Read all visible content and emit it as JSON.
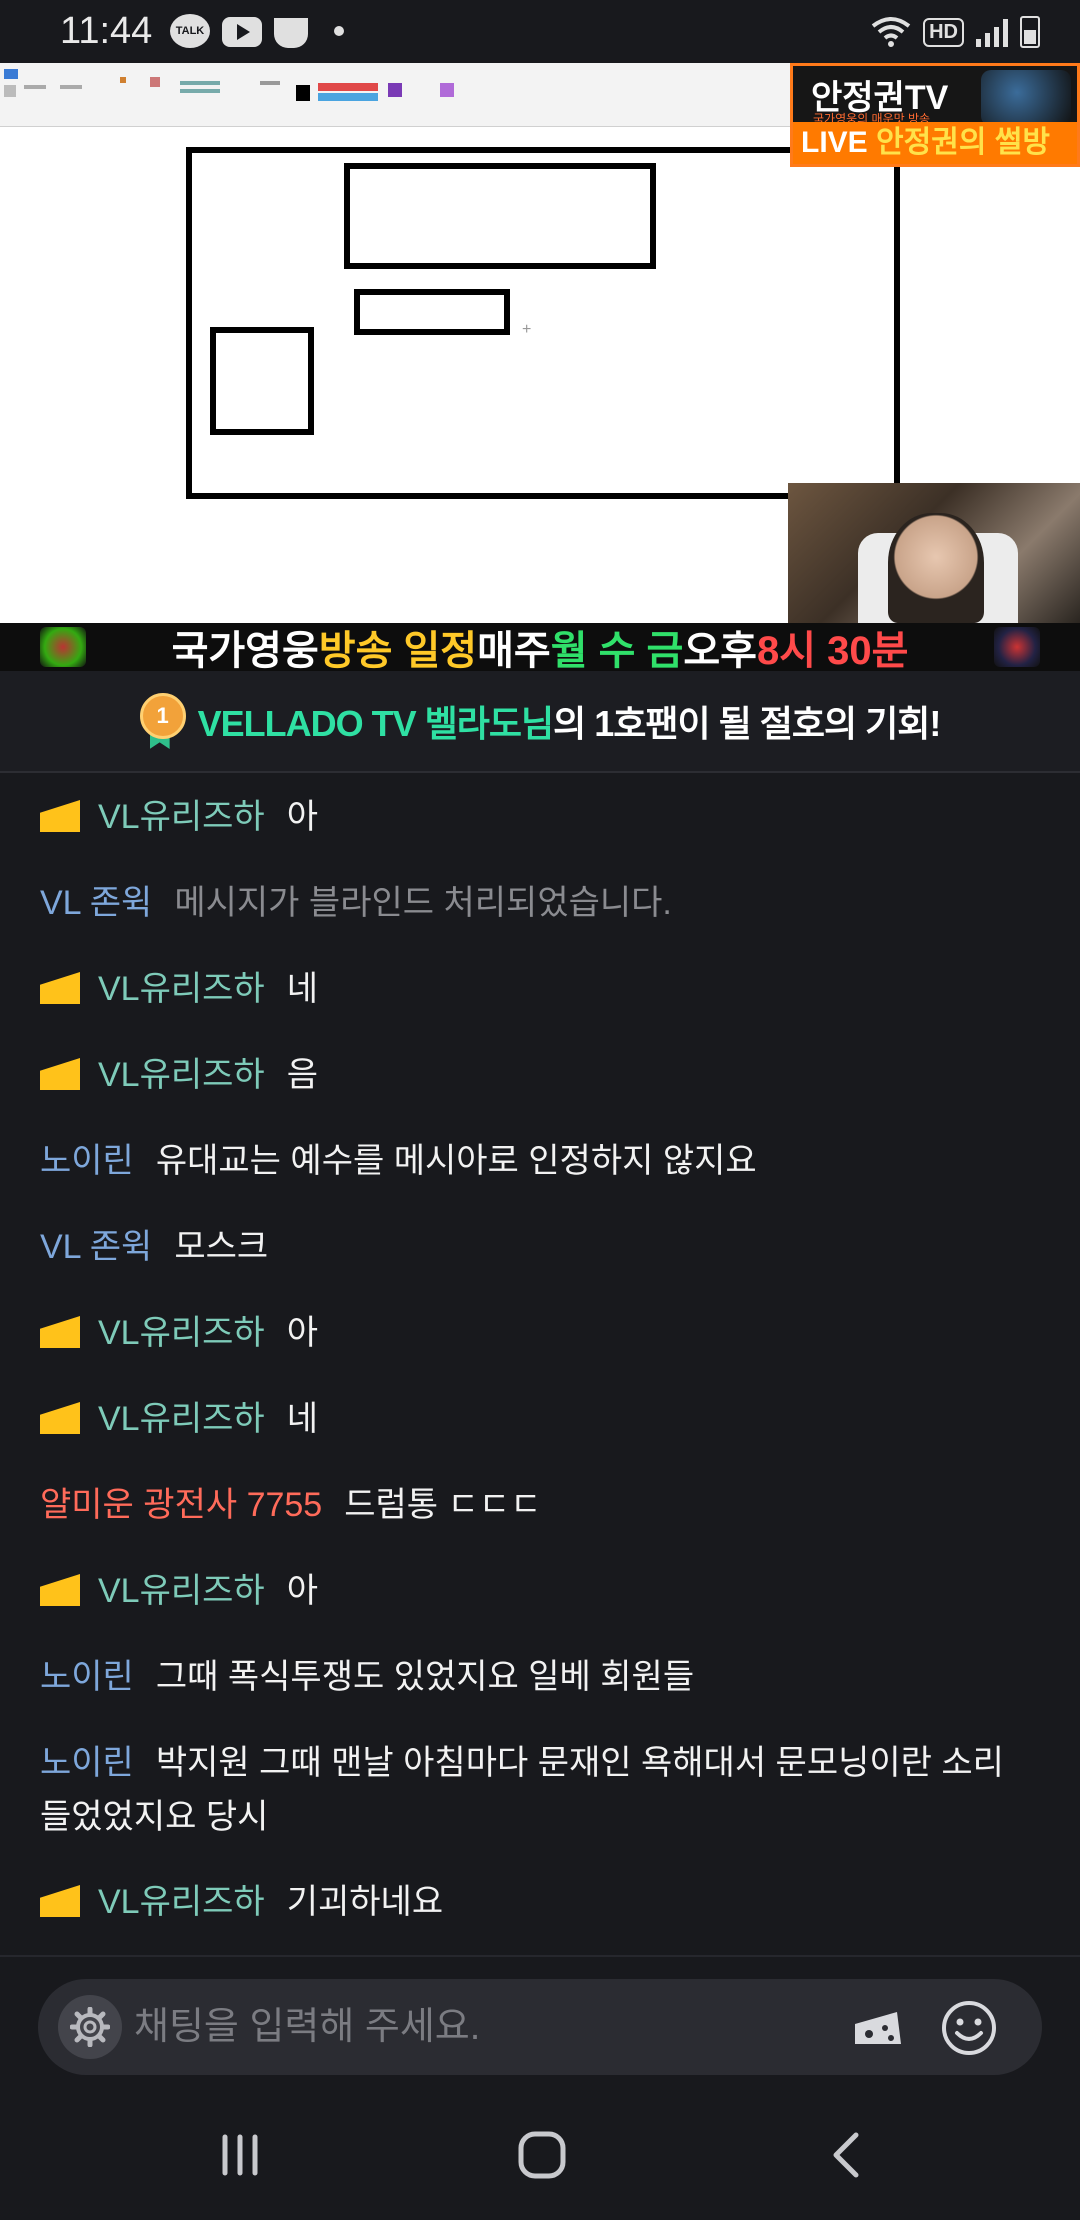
{
  "status_bar": {
    "time": "11:44",
    "talk_label": "TALK",
    "hd_label": "HD",
    "icons": [
      "kakaotalk-icon",
      "youtube-icon",
      "cup-icon",
      "dot-icon",
      "wifi-icon",
      "signal-icon",
      "battery-icon"
    ]
  },
  "stream": {
    "channel_logo_title": "안정권TV",
    "channel_logo_sub": "국가영웅의 매운맛 방송",
    "live_label": "LIVE",
    "live_title": "안정권의 썰방",
    "ticker": {
      "part1": "국가영웅 ",
      "part2": "방송 일정",
      "part3": " 매주 ",
      "part4": "월 수 금",
      "part5": " 오후 ",
      "part6": "8시 30분"
    }
  },
  "promo": {
    "badge": "1",
    "highlight": "VELLADO TV 벨라도님",
    "rest": "의 1호팬이 될 절호의 기회!"
  },
  "chat": {
    "messages": [
      {
        "nick": "VL유리즈하",
        "text": "아",
        "badge": "cheese",
        "color": "#7ecbb9"
      },
      {
        "nick": "VL 존윅",
        "text": "메시지가 블라인드 처리되었습니다.",
        "badge": "",
        "color": "#7ea7db"
      },
      {
        "nick": "VL유리즈하",
        "text": "네",
        "badge": "cheese",
        "color": "#7ecbb9"
      },
      {
        "nick": "VL유리즈하",
        "text": "음",
        "badge": "cheese",
        "color": "#7ecbb9"
      },
      {
        "nick": "노이린",
        "text": "유대교는 예수를 메시아로 인정하지 않지요",
        "badge": "",
        "color": "#7ea7db"
      },
      {
        "nick": "VL 존윅",
        "text": "모스크",
        "badge": "",
        "color": "#7ea7db"
      },
      {
        "nick": "VL유리즈하",
        "text": "아",
        "badge": "cheese",
        "color": "#7ecbb9"
      },
      {
        "nick": "VL유리즈하",
        "text": "네",
        "badge": "cheese",
        "color": "#7ecbb9"
      },
      {
        "nick": "얄미운 광전사 7755",
        "text": "드럼통 ㄷㄷㄷ",
        "badge": "",
        "color": "#ff6b5a"
      },
      {
        "nick": "VL유리즈하",
        "text": "아",
        "badge": "cheese",
        "color": "#7ecbb9"
      },
      {
        "nick": "노이린",
        "text": "그때 폭식투쟁도 있었지요 일베 회원들",
        "badge": "",
        "color": "#7ea7db"
      },
      {
        "nick": "노이린",
        "text": "박지원 그때 맨날 아침마다 문재인 욕해대서 문모닝이란 소리 들었었지요 당시",
        "badge": "",
        "color": "#7ea7db"
      },
      {
        "nick": "VL유리즈하",
        "text": "기괴하네요",
        "badge": "cheese",
        "color": "#7ecbb9"
      }
    ]
  },
  "input": {
    "placeholder": "채팅을 입력해 주세요.",
    "value": ""
  },
  "colors": {
    "background": "#18191d",
    "nick_teal": "#7ecbb9",
    "nick_blue": "#7ea7db",
    "nick_red": "#ff6b5a",
    "promo_green": "#2fe0a3"
  }
}
